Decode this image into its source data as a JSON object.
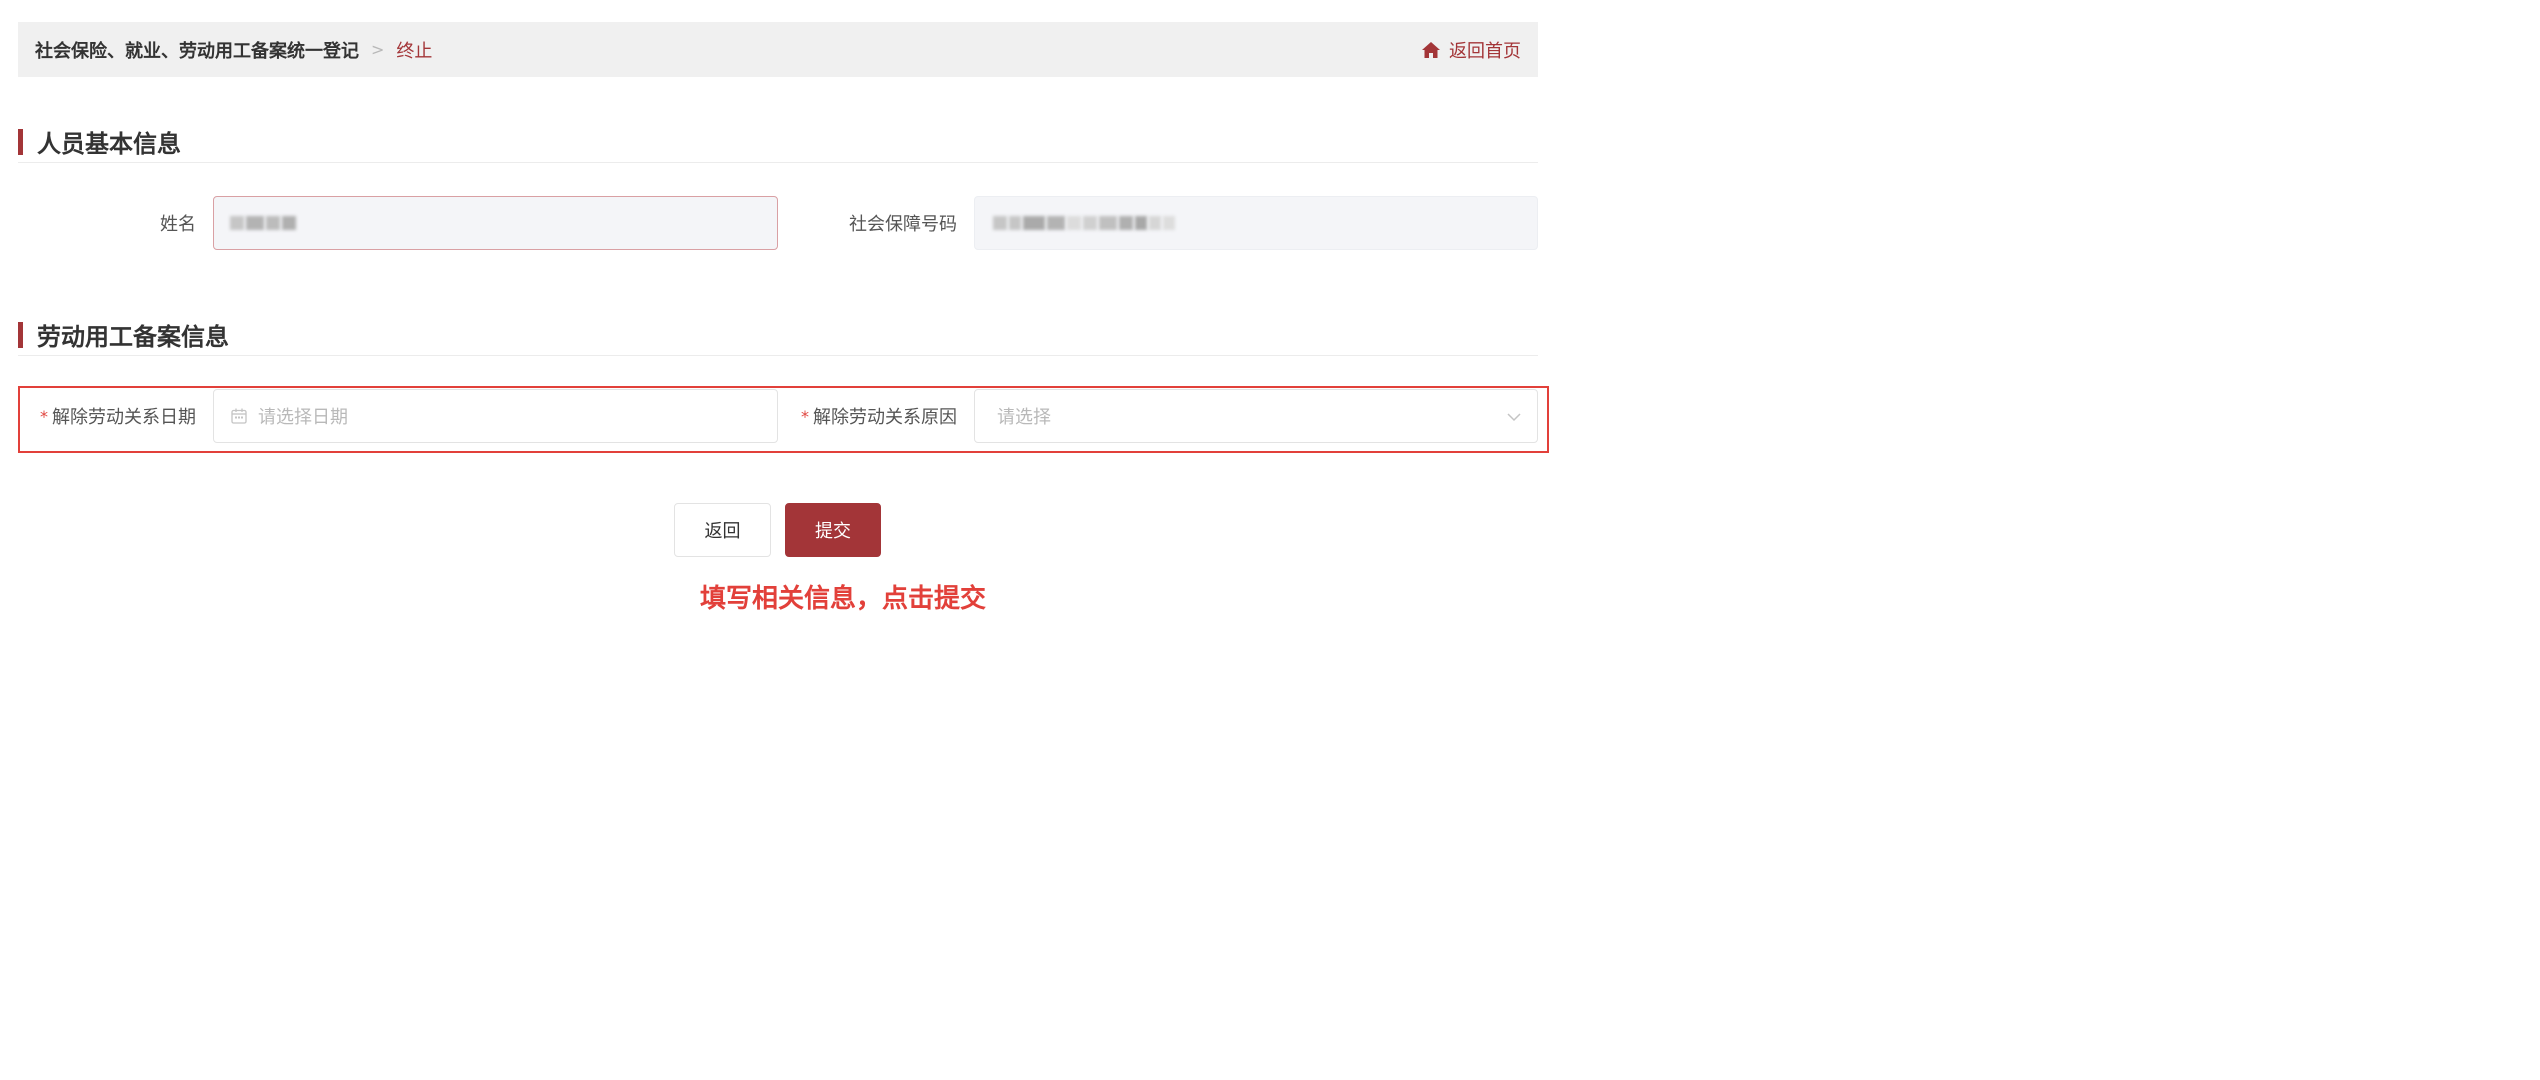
{
  "breadcrumb": {
    "root": "社会保险、就业、劳动用工备案统一登记",
    "separator": ">",
    "current": "终止"
  },
  "home_link": {
    "label": "返回首页",
    "icon": "home-icon"
  },
  "sections": {
    "personal": {
      "title": "人员基本信息"
    },
    "employment": {
      "title": "劳动用工备案信息"
    }
  },
  "fields": {
    "name": {
      "label": "姓名"
    },
    "ssn": {
      "label": "社会保障号码"
    },
    "termination_date": {
      "required_mark": "*",
      "label": "解除劳动关系日期",
      "placeholder": "请选择日期",
      "icon": "calendar-icon"
    },
    "termination_reason": {
      "required_mark": "*",
      "label": "解除劳动关系原因",
      "placeholder": "请选择",
      "icon": "chevron-down-icon"
    }
  },
  "buttons": {
    "back": "返回",
    "submit": "提交"
  },
  "hint": "填写相关信息，点击提交",
  "colors": {
    "accent": "#a33538",
    "highlight": "#e2403a",
    "topbar": "#f0f0f0"
  }
}
